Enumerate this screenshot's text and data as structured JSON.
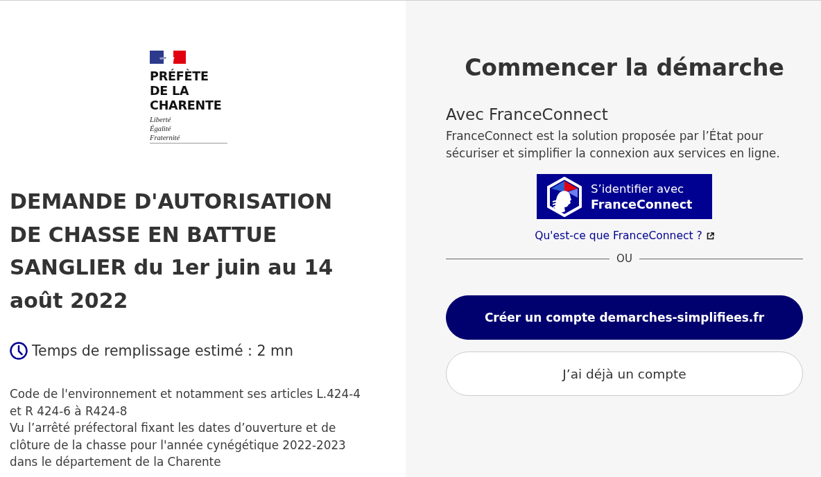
{
  "logo": {
    "lines": [
      "PRÉFÈTE",
      "DE LA",
      "CHARENTE"
    ],
    "motto": [
      "Liberté",
      "Égalité",
      "Fraternité"
    ]
  },
  "procedure": {
    "title": "DEMANDE D'AUTORISATION DE CHASSE EN BATTUE SANGLIER du 1er juin au 14 août 2022",
    "estimated_time": "Temps de remplissage estimé : 2 mn",
    "description": [
      "Code de l'environnement et notamment ses articles L.424-4 et R 424-6 à R424-8",
      "Vu l’arrêté préfectoral fixant les dates d’ouverture et de clôture de la chasse pour l'année cynégétique 2022-2023 dans le département de la Charente"
    ]
  },
  "start": {
    "title": "Commencer la démarche",
    "franceconnect": {
      "heading": "Avec FranceConnect",
      "text": "FranceConnect est la solution proposée par l’État pour sécuriser et simplifier la connexion aux services en ligne.",
      "button": {
        "line_1": "S’identifier avec",
        "line_2": "FranceConnect"
      },
      "link": "Qu'est-ce que FranceConnect ?"
    },
    "separator": "OU",
    "buttons": [
      {
        "label": "Créer un compte demarches-simplifiees.fr",
        "kind": "primary"
      },
      {
        "label": "J’ai déjà un compte",
        "kind": "secondary"
      }
    ]
  }
}
